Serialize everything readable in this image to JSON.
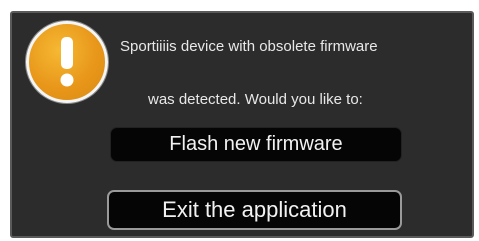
{
  "dialog": {
    "icon": "warning-exclamation-icon",
    "accent_color": "#e8971a",
    "message_line1": "Sportiiiis device with obsolete firmware",
    "message_line2": "was detected. Would you like to:",
    "buttons": {
      "flash_label": "Flash new firmware",
      "exit_label": "Exit the application"
    }
  }
}
